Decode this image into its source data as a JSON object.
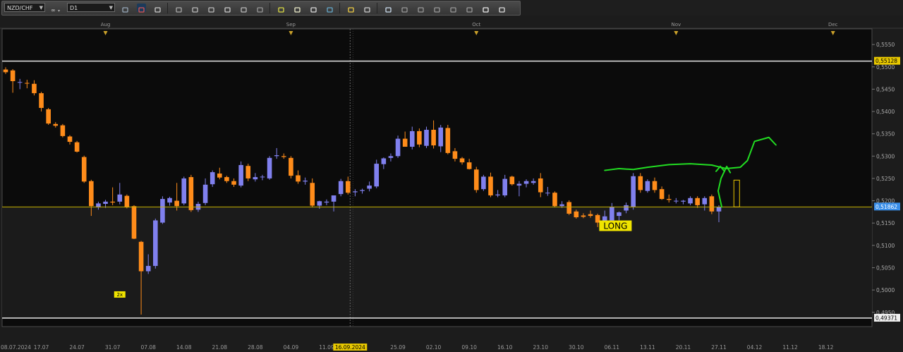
{
  "toolbar": {
    "symbol": "NZD/CHF",
    "timeframe": "D1",
    "icons": [
      "link-icon",
      "chart-type-icon",
      "bar-style-icon",
      "indicator-icon",
      "zoom-in-icon",
      "zoom-out-icon",
      "cursor-icon",
      "pan-icon",
      "crosshair-icon",
      "text-icon",
      "note-icon",
      "camera-icon",
      "globe-icon",
      "pencil-icon",
      "order-icon",
      "template-icon",
      "line-tool-icon",
      "channel-icon",
      "fibonacci-icon",
      "trend-icon",
      "shape-icon",
      "eraser-icon",
      "more-icon"
    ]
  },
  "chart_data": {
    "type": "candlestick",
    "symbol": "NZD/CHF",
    "timeframe": "D1",
    "ylim": [
      0.4918,
      0.5585
    ],
    "y_ticks": [
      "0,5550",
      "0,5500",
      "0,5450",
      "0,5400",
      "0,5350",
      "0,5300",
      "0,5250",
      "0,5200",
      "0,5150",
      "0,5100",
      "0,5050",
      "0,5000",
      "0,4950"
    ],
    "month_markers": [
      {
        "label": "Aug",
        "bar": 14
      },
      {
        "label": "Sep",
        "bar": 40
      },
      {
        "label": "Oct",
        "bar": 66
      },
      {
        "label": "Nov",
        "bar": 94
      },
      {
        "label": "Dec",
        "bar": 116
      }
    ],
    "x_ticks": [
      {
        "label": "08.07.2024",
        "bar": -0.5
      },
      {
        "label": "17.07",
        "bar": 5
      },
      {
        "label": "24.07",
        "bar": 10
      },
      {
        "label": "31.07",
        "bar": 15
      },
      {
        "label": "07.08",
        "bar": 20
      },
      {
        "label": "14.08",
        "bar": 25
      },
      {
        "label": "21.08",
        "bar": 30
      },
      {
        "label": "28.08",
        "bar": 35
      },
      {
        "label": "04.09",
        "bar": 40
      },
      {
        "label": "11.09",
        "bar": 45
      },
      {
        "label": "19",
        "bar": 50
      },
      {
        "label": "25.09",
        "bar": 55
      },
      {
        "label": "02.10",
        "bar": 60
      },
      {
        "label": "09.10",
        "bar": 65
      },
      {
        "label": "16.10",
        "bar": 70
      },
      {
        "label": "23.10",
        "bar": 75
      },
      {
        "label": "30.10",
        "bar": 80
      },
      {
        "label": "06.11",
        "bar": 85
      },
      {
        "label": "13.11",
        "bar": 90
      },
      {
        "label": "20.11",
        "bar": 95
      },
      {
        "label": "27.11",
        "bar": 100
      },
      {
        "label": "04.12",
        "bar": 105
      },
      {
        "label": "11.12",
        "bar": 110
      },
      {
        "label": "18.12",
        "bar": 115
      }
    ],
    "crosshair": {
      "label": "16.09.2024",
      "bar": 48.3
    },
    "horizontal_lines": [
      {
        "value": 0.55128,
        "label": "0,55128",
        "color": "#e8e8e8",
        "label_bg": "#e8c800",
        "label_color": "#000000"
      },
      {
        "value": 0.51862,
        "label": "0,51862",
        "color": "#c8b400",
        "label_bg": "#3a8ee8",
        "label_color": "#ffffff"
      },
      {
        "value": 0.49371,
        "label": "0,49371",
        "color": "#e8e8e8",
        "label_bg": "#f0f0f0",
        "label_color": "#000000"
      }
    ],
    "annotations": [
      {
        "text": "LONG",
        "bar": 85.5,
        "value": 0.5144,
        "bg": "#f0e400",
        "color": "#000000"
      },
      {
        "text": "2x",
        "bar": 16,
        "value": 0.499,
        "bg": "#f0e400",
        "color": "#000000"
      }
    ],
    "projection_box": {
      "bar": 102.5,
      "open": 0.51862,
      "close": 0.52462,
      "color": "#e8c400"
    },
    "drawing_color": "#22dd22",
    "drawing_points": [
      [
        84,
        0.5268
      ],
      [
        86,
        0.5272
      ],
      [
        88,
        0.527
      ],
      [
        90,
        0.5275
      ],
      [
        93,
        0.5281
      ],
      [
        96,
        0.5283
      ],
      [
        99,
        0.528
      ],
      [
        101,
        0.5272
      ],
      [
        103,
        0.5275
      ],
      [
        104,
        0.529
      ],
      [
        105,
        0.5333
      ],
      [
        107,
        0.5342
      ],
      [
        108,
        0.5325
      ]
    ],
    "drawing_arrow": [
      [
        100.4,
        0.5186
      ],
      [
        99.9,
        0.5222
      ],
      [
        100.3,
        0.525
      ],
      [
        101.1,
        0.5277
      ],
      [
        101.6,
        0.5263
      ]
    ],
    "up_color": "#8080ee",
    "down_color": "#ff8c1a",
    "candles": [
      {
        "o": 0.5494,
        "h": 0.5499,
        "l": 0.5484,
        "c": 0.5488
      },
      {
        "o": 0.5492,
        "h": 0.5495,
        "l": 0.5442,
        "c": 0.5468
      },
      {
        "o": 0.5466,
        "h": 0.5473,
        "l": 0.545,
        "c": 0.5466
      },
      {
        "o": 0.5464,
        "h": 0.5471,
        "l": 0.5452,
        "c": 0.5463
      },
      {
        "o": 0.5462,
        "h": 0.547,
        "l": 0.5436,
        "c": 0.5441
      },
      {
        "o": 0.5441,
        "h": 0.5444,
        "l": 0.54,
        "c": 0.5408
      },
      {
        "o": 0.5405,
        "h": 0.5408,
        "l": 0.537,
        "c": 0.5373
      },
      {
        "o": 0.5372,
        "h": 0.5376,
        "l": 0.5364,
        "c": 0.5368
      },
      {
        "o": 0.5369,
        "h": 0.5372,
        "l": 0.5342,
        "c": 0.5345
      },
      {
        "o": 0.5344,
        "h": 0.5347,
        "l": 0.5326,
        "c": 0.5332
      },
      {
        "o": 0.5331,
        "h": 0.5334,
        "l": 0.5308,
        "c": 0.531
      },
      {
        "o": 0.5298,
        "h": 0.5301,
        "l": 0.524,
        "c": 0.5243
      },
      {
        "o": 0.5244,
        "h": 0.5247,
        "l": 0.5166,
        "c": 0.5188
      },
      {
        "o": 0.5185,
        "h": 0.5198,
        "l": 0.518,
        "c": 0.5194
      },
      {
        "o": 0.5193,
        "h": 0.5202,
        "l": 0.5184,
        "c": 0.5198
      },
      {
        "o": 0.5198,
        "h": 0.523,
        "l": 0.519,
        "c": 0.5196
      },
      {
        "o": 0.5198,
        "h": 0.524,
        "l": 0.5192,
        "c": 0.5214
      },
      {
        "o": 0.5211,
        "h": 0.5214,
        "l": 0.5183,
        "c": 0.5185
      },
      {
        "o": 0.5188,
        "h": 0.519,
        "l": 0.5114,
        "c": 0.5115
      },
      {
        "o": 0.5108,
        "h": 0.511,
        "l": 0.4945,
        "c": 0.5042
      },
      {
        "o": 0.5042,
        "h": 0.508,
        "l": 0.5036,
        "c": 0.5054
      },
      {
        "o": 0.5054,
        "h": 0.516,
        "l": 0.5048,
        "c": 0.5156
      },
      {
        "o": 0.5151,
        "h": 0.521,
        "l": 0.5148,
        "c": 0.5204
      },
      {
        "o": 0.5196,
        "h": 0.5209,
        "l": 0.5189,
        "c": 0.5206
      },
      {
        "o": 0.52,
        "h": 0.524,
        "l": 0.5178,
        "c": 0.5188
      },
      {
        "o": 0.5194,
        "h": 0.5254,
        "l": 0.519,
        "c": 0.525
      },
      {
        "o": 0.5253,
        "h": 0.5258,
        "l": 0.5175,
        "c": 0.5179
      },
      {
        "o": 0.518,
        "h": 0.5198,
        "l": 0.5175,
        "c": 0.5193
      },
      {
        "o": 0.5195,
        "h": 0.525,
        "l": 0.519,
        "c": 0.5236
      },
      {
        "o": 0.5237,
        "h": 0.5268,
        "l": 0.5231,
        "c": 0.5264
      },
      {
        "o": 0.5261,
        "h": 0.5274,
        "l": 0.5248,
        "c": 0.5252
      },
      {
        "o": 0.5253,
        "h": 0.5256,
        "l": 0.524,
        "c": 0.5244
      },
      {
        "o": 0.5244,
        "h": 0.525,
        "l": 0.5231,
        "c": 0.5236
      },
      {
        "o": 0.5234,
        "h": 0.5288,
        "l": 0.523,
        "c": 0.528
      },
      {
        "o": 0.5278,
        "h": 0.5283,
        "l": 0.5244,
        "c": 0.525
      },
      {
        "o": 0.5248,
        "h": 0.5262,
        "l": 0.5243,
        "c": 0.5253
      },
      {
        "o": 0.5254,
        "h": 0.5258,
        "l": 0.5246,
        "c": 0.5254
      },
      {
        "o": 0.525,
        "h": 0.53,
        "l": 0.5247,
        "c": 0.5296
      },
      {
        "o": 0.53,
        "h": 0.5318,
        "l": 0.5294,
        "c": 0.5302
      },
      {
        "o": 0.53,
        "h": 0.5306,
        "l": 0.5294,
        "c": 0.5298
      },
      {
        "o": 0.5296,
        "h": 0.53,
        "l": 0.525,
        "c": 0.5256
      },
      {
        "o": 0.5257,
        "h": 0.5268,
        "l": 0.5238,
        "c": 0.5243
      },
      {
        "o": 0.5243,
        "h": 0.5252,
        "l": 0.5236,
        "c": 0.5245
      },
      {
        "o": 0.524,
        "h": 0.525,
        "l": 0.5185,
        "c": 0.5189
      },
      {
        "o": 0.5189,
        "h": 0.52,
        "l": 0.5182,
        "c": 0.5199
      },
      {
        "o": 0.5196,
        "h": 0.5203,
        "l": 0.519,
        "c": 0.5198
      },
      {
        "o": 0.5198,
        "h": 0.5212,
        "l": 0.5176,
        "c": 0.5212
      },
      {
        "o": 0.5215,
        "h": 0.5249,
        "l": 0.521,
        "c": 0.5244
      },
      {
        "o": 0.5244,
        "h": 0.5254,
        "l": 0.5214,
        "c": 0.5218
      },
      {
        "o": 0.5219,
        "h": 0.5226,
        "l": 0.521,
        "c": 0.5221
      },
      {
        "o": 0.5222,
        "h": 0.5227,
        "l": 0.5216,
        "c": 0.5224
      },
      {
        "o": 0.5227,
        "h": 0.5243,
        "l": 0.5221,
        "c": 0.5234
      },
      {
        "o": 0.5232,
        "h": 0.5292,
        "l": 0.5228,
        "c": 0.5283
      },
      {
        "o": 0.5282,
        "h": 0.5297,
        "l": 0.5271,
        "c": 0.5295
      },
      {
        "o": 0.5296,
        "h": 0.5306,
        "l": 0.5288,
        "c": 0.53
      },
      {
        "o": 0.53,
        "h": 0.5346,
        "l": 0.5296,
        "c": 0.5339
      },
      {
        "o": 0.5339,
        "h": 0.5355,
        "l": 0.5321,
        "c": 0.5321
      },
      {
        "o": 0.5321,
        "h": 0.5366,
        "l": 0.5315,
        "c": 0.5356
      },
      {
        "o": 0.5356,
        "h": 0.5362,
        "l": 0.532,
        "c": 0.5326
      },
      {
        "o": 0.5323,
        "h": 0.5366,
        "l": 0.5318,
        "c": 0.5359
      },
      {
        "o": 0.5359,
        "h": 0.538,
        "l": 0.5317,
        "c": 0.5324
      },
      {
        "o": 0.5322,
        "h": 0.537,
        "l": 0.5309,
        "c": 0.5364
      },
      {
        "o": 0.5363,
        "h": 0.537,
        "l": 0.5304,
        "c": 0.5307
      },
      {
        "o": 0.5311,
        "h": 0.5318,
        "l": 0.5288,
        "c": 0.5294
      },
      {
        "o": 0.5295,
        "h": 0.5298,
        "l": 0.5281,
        "c": 0.5286
      },
      {
        "o": 0.5286,
        "h": 0.5294,
        "l": 0.527,
        "c": 0.5271
      },
      {
        "o": 0.527,
        "h": 0.5276,
        "l": 0.5218,
        "c": 0.5224
      },
      {
        "o": 0.5226,
        "h": 0.5258,
        "l": 0.5222,
        "c": 0.5254
      },
      {
        "o": 0.5254,
        "h": 0.5263,
        "l": 0.5208,
        "c": 0.5212
      },
      {
        "o": 0.5212,
        "h": 0.5224,
        "l": 0.5208,
        "c": 0.5214
      },
      {
        "o": 0.5212,
        "h": 0.5258,
        "l": 0.5208,
        "c": 0.5249
      },
      {
        "o": 0.5254,
        "h": 0.5256,
        "l": 0.5234,
        "c": 0.5237
      },
      {
        "o": 0.5234,
        "h": 0.5244,
        "l": 0.521,
        "c": 0.5238
      },
      {
        "o": 0.5238,
        "h": 0.5248,
        "l": 0.523,
        "c": 0.5244
      },
      {
        "o": 0.524,
        "h": 0.525,
        "l": 0.5236,
        "c": 0.5244
      },
      {
        "o": 0.525,
        "h": 0.5262,
        "l": 0.5208,
        "c": 0.5219
      },
      {
        "o": 0.5218,
        "h": 0.5231,
        "l": 0.5211,
        "c": 0.5218
      },
      {
        "o": 0.5218,
        "h": 0.5221,
        "l": 0.5185,
        "c": 0.5188
      },
      {
        "o": 0.5188,
        "h": 0.5199,
        "l": 0.5184,
        "c": 0.5192
      },
      {
        "o": 0.5197,
        "h": 0.5201,
        "l": 0.5168,
        "c": 0.5171
      },
      {
        "o": 0.5176,
        "h": 0.518,
        "l": 0.516,
        "c": 0.5163
      },
      {
        "o": 0.5167,
        "h": 0.5172,
        "l": 0.5161,
        "c": 0.5164
      },
      {
        "o": 0.517,
        "h": 0.5178,
        "l": 0.5162,
        "c": 0.5166
      },
      {
        "o": 0.5168,
        "h": 0.5171,
        "l": 0.5141,
        "c": 0.5151
      },
      {
        "o": 0.5148,
        "h": 0.5178,
        "l": 0.5144,
        "c": 0.5165
      },
      {
        "o": 0.5152,
        "h": 0.5195,
        "l": 0.5148,
        "c": 0.5186
      },
      {
        "o": 0.5166,
        "h": 0.5176,
        "l": 0.515,
        "c": 0.5174
      },
      {
        "o": 0.5178,
        "h": 0.5196,
        "l": 0.5172,
        "c": 0.519
      },
      {
        "o": 0.5186,
        "h": 0.5262,
        "l": 0.518,
        "c": 0.5255
      },
      {
        "o": 0.5255,
        "h": 0.5262,
        "l": 0.5218,
        "c": 0.5224
      },
      {
        "o": 0.5222,
        "h": 0.5248,
        "l": 0.5218,
        "c": 0.5244
      },
      {
        "o": 0.5244,
        "h": 0.5252,
        "l": 0.5218,
        "c": 0.5224
      },
      {
        "o": 0.5226,
        "h": 0.5232,
        "l": 0.5202,
        "c": 0.5204
      },
      {
        "o": 0.5204,
        "h": 0.5214,
        "l": 0.5196,
        "c": 0.5202
      },
      {
        "o": 0.52,
        "h": 0.5206,
        "l": 0.5194,
        "c": 0.52
      },
      {
        "o": 0.5198,
        "h": 0.5202,
        "l": 0.5192,
        "c": 0.52
      },
      {
        "o": 0.5194,
        "h": 0.521,
        "l": 0.519,
        "c": 0.5206
      },
      {
        "o": 0.5206,
        "h": 0.521,
        "l": 0.5184,
        "c": 0.519
      },
      {
        "o": 0.5192,
        "h": 0.521,
        "l": 0.5178,
        "c": 0.5206
      },
      {
        "o": 0.521,
        "h": 0.5214,
        "l": 0.517,
        "c": 0.5176
      },
      {
        "o": 0.5176,
        "h": 0.519,
        "l": 0.5152,
        "c": 0.5186
      }
    ]
  }
}
